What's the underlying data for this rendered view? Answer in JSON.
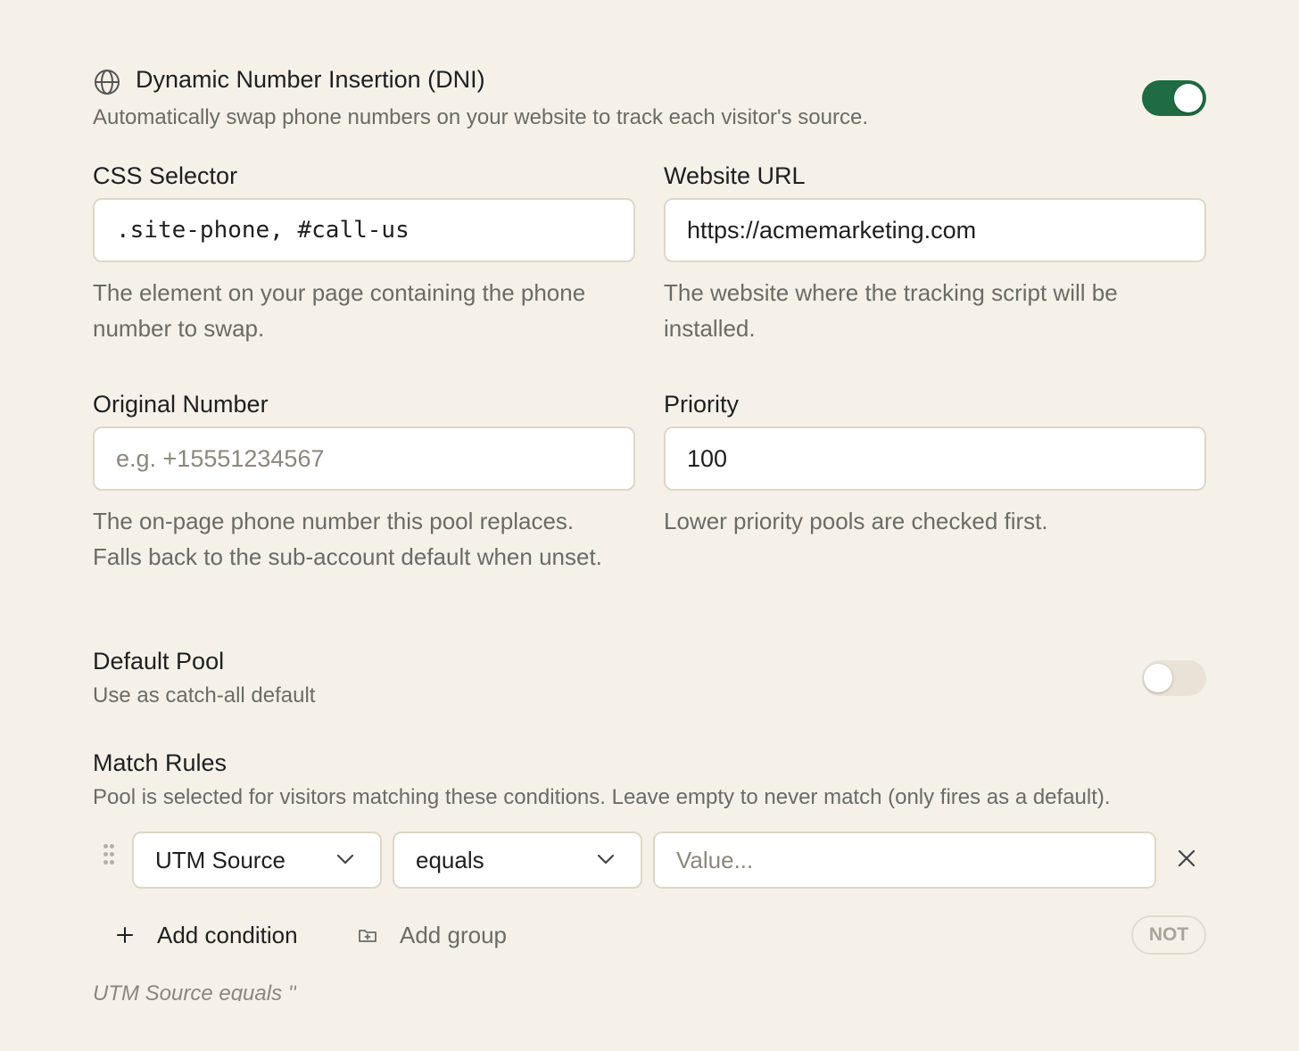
{
  "dni": {
    "title": "Dynamic Number Insertion (DNI)",
    "description": "Automatically swap phone numbers on your website to track each visitor's source.",
    "enabled": true,
    "icon": "globe-icon"
  },
  "css_selector": {
    "label": "CSS Selector",
    "value": ".site-phone, #call-us",
    "hint": "The element on your page containing the phone number to swap."
  },
  "website_url": {
    "label": "Website URL",
    "value": "https://acmemarketing.com",
    "hint": "The website where the tracking script will be installed."
  },
  "original_number": {
    "label": "Original Number",
    "placeholder": "e.g. +15551234567",
    "hint": "The on-page phone number this pool replaces. Falls back to the sub-account default when unset."
  },
  "priority": {
    "label": "Priority",
    "value": "100",
    "hint": "Lower priority pools are checked first."
  },
  "default_pool": {
    "title": "Default Pool",
    "description": "Use as catch-all default",
    "enabled": false
  },
  "match_rules": {
    "title": "Match Rules",
    "description": "Pool is selected for visitors matching these conditions. Leave empty to never match (only fires as a default).",
    "rules": [
      {
        "field": "UTM Source",
        "operator": "equals",
        "value_placeholder": "Value..."
      }
    ],
    "add_condition_label": "Add condition",
    "add_group_label": "Add group",
    "not_label": "NOT",
    "summary": "UTM Source equals ''"
  },
  "colors": {
    "background": "#f5f1e8",
    "accent": "#1f6b43",
    "muted_text": "#6b6b63"
  }
}
